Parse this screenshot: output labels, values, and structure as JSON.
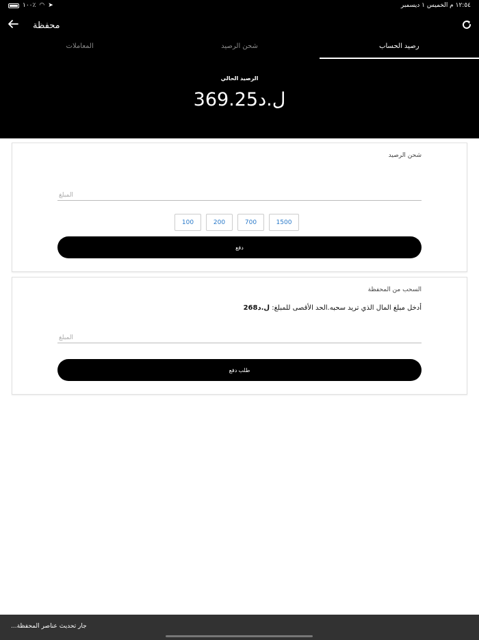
{
  "status_bar": {
    "time": "١٢:٥٤ م  الخميس ١ ديسمبر",
    "battery": "١٠٠٪"
  },
  "app_bar": {
    "title": "محفظة"
  },
  "tabs": [
    {
      "label": "رصيد الحساب",
      "active": true
    },
    {
      "label": "شحن الرصيد",
      "active": false
    },
    {
      "label": "المعاملات",
      "active": false
    }
  ],
  "balance": {
    "label": "الرصيد الحالي",
    "value": "369.25ل.د"
  },
  "topup": {
    "title": "شحن الرصيد",
    "amount_placeholder": "المبلغ",
    "chips": [
      "100",
      "200",
      "700",
      "1500"
    ],
    "pay_label": "دفع"
  },
  "withdraw": {
    "title": "السحب من المحفظة",
    "description": "أدخل مبلغ المال الذي تريد سحبه.الحد الأقصى للمبلغ: ",
    "max_amount": "ل.د268",
    "amount_placeholder": "المبلغ",
    "request_label": "طلب دفع"
  },
  "snackbar": {
    "text": "جار تحديث عناصر المحفظة..."
  },
  "colors": {
    "header_bg": "#000000",
    "chip_text": "#2979c9",
    "snackbar_bg": "#323232"
  }
}
